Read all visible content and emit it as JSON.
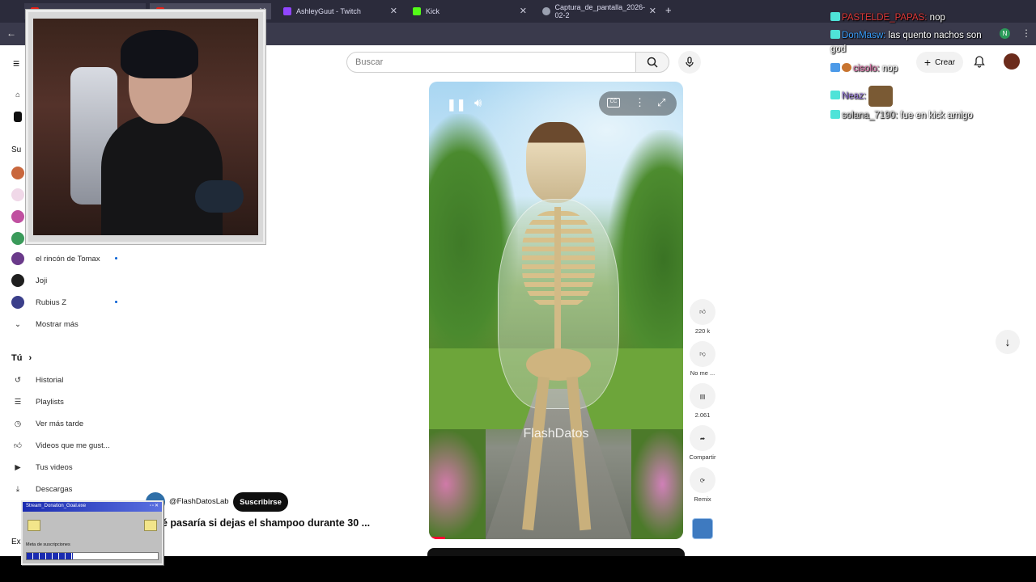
{
  "browser": {
    "tabs": [
      {
        "label": "",
        "icon": "youtube-icon",
        "active": false
      },
      {
        "label": "",
        "icon": "youtube-icon",
        "active": true
      },
      {
        "label": "AshleyGuut - Twitch",
        "icon": "twitch-icon",
        "active": false
      },
      {
        "label": "Kick",
        "icon": "kick-icon",
        "active": false
      },
      {
        "label": "Captura_de_pantalla_2026-02-2",
        "icon": "globe-icon",
        "active": false
      }
    ],
    "new_tab": "+"
  },
  "header": {
    "search_placeholder": "Buscar",
    "create_label": "Crear"
  },
  "sidebar": {
    "sub_heading_partial": "Su",
    "subscriptions": [
      {
        "label": "el rincón de Tomax",
        "live": true,
        "color": "#6a3a8a"
      },
      {
        "label": "Joji",
        "live": false,
        "color": "#1f1f1f"
      },
      {
        "label": "Rubius Z",
        "live": true,
        "color": "#3b3f8a"
      }
    ],
    "show_more": "Mostrar más",
    "you_heading": "Tú",
    "you_items": [
      {
        "label": "Historial",
        "icon": "history-icon"
      },
      {
        "label": "Playlists",
        "icon": "playlist-icon"
      },
      {
        "label": "Ver más tarde",
        "icon": "clock-icon"
      },
      {
        "label": "Videos que me gust...",
        "icon": "thumbs-up-icon"
      },
      {
        "label": "Tus videos",
        "icon": "video-icon"
      },
      {
        "label": "Descargas",
        "icon": "download-icon"
      }
    ],
    "explore_partial": "Ex"
  },
  "video": {
    "watermark": "FlashDatos",
    "channel_handle": "@FlashDatosLab",
    "subscribe_label": "Suscribirse",
    "title": "é pasaría si dejas el shampoo durante 30 ..."
  },
  "actions": {
    "like_count": "220 k",
    "dislike_label": "No me ...",
    "comment_count": "2.061",
    "share_label": "Compartir",
    "remix_label": "Remix"
  },
  "chat": [
    {
      "user": "PASTELDE_PAPAS:",
      "message": "nop",
      "user_color": "#e03a3a"
    },
    {
      "user": "DonMasw:",
      "message": "las quento nachos son",
      "user_color": "#3aa0ff"
    },
    {
      "user": "",
      "message": "god",
      "user_color": "#ffffff"
    },
    {
      "user": "cisolo:",
      "message": "nop",
      "user_color": "#e06fa8"
    },
    {
      "user": "Neaz:",
      "message": "",
      "user_color": "#9a7adf"
    },
    {
      "user": "solana_7190:",
      "message": "fue en kick amigo",
      "user_color": "#d0d0d0"
    }
  ],
  "donation_widget": {
    "title": "Stream_Donation_Goal.exe",
    "label": "Meta de suscripciones",
    "progress": 0.35
  }
}
